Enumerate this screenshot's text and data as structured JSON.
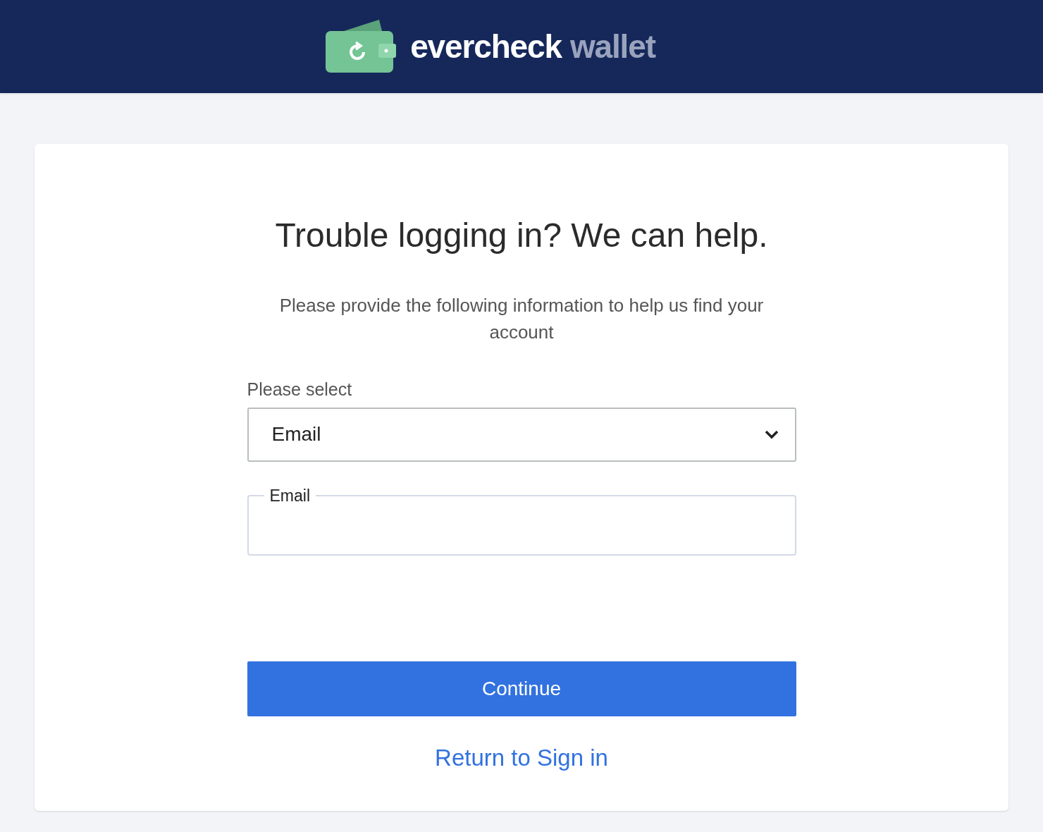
{
  "header": {
    "logo": {
      "primary": "evercheck",
      "secondary": "wallet"
    }
  },
  "card": {
    "title": "Trouble logging in? We can help.",
    "subtitle": "Please provide the following information to help us find your account",
    "select": {
      "label": "Please select",
      "value": "Email"
    },
    "email_field": {
      "label": "Email"
    },
    "continue_button": "Continue",
    "return_link": "Return to Sign in"
  }
}
